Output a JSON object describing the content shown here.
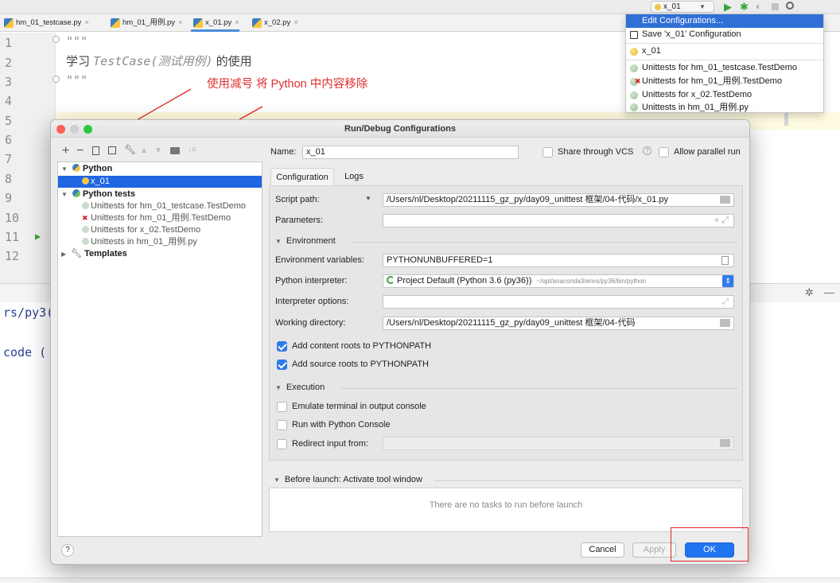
{
  "run_toolbar": {
    "config_name": "x_01",
    "dropdown_arrow": "▼"
  },
  "tabs": [
    {
      "label": "hm_01_testcase.py"
    },
    {
      "label": "hm_01_用例.py"
    },
    {
      "label": "x_01.py"
    },
    {
      "label": "x_02.py"
    }
  ],
  "editor": {
    "line_numbers": [
      "1",
      "2",
      "3",
      "4",
      "5",
      "6",
      "7",
      "8",
      "9",
      "10",
      "11",
      "12"
    ],
    "code_line1": "\"\"\"",
    "code_line2_prefix": "学习 ",
    "code_line2_italic": "TestCase(测试用例)",
    "code_line2_suffix": " 的使用",
    "code_line3": "\"\"\""
  },
  "annotation": "使用减号 将 Python 中内容移除",
  "console": {
    "line1": "rs/py3(",
    "line2": "code ("
  },
  "dropdown": {
    "items": [
      {
        "label": "Edit Configurations...",
        "icon": "none",
        "selected": true
      },
      {
        "label": "Save 'x_01' Configuration",
        "icon": "save-icon"
      },
      {
        "label": "x_01",
        "icon": "python-icon"
      },
      {
        "label": "Unittests for hm_01_testcase.TestDemo",
        "icon": "unittest-icon"
      },
      {
        "label": "Unittests for hm_01_用例.TestDemo",
        "icon": "unittest-error-icon"
      },
      {
        "label": "Unittests for x_02.TestDemo",
        "icon": "unittest-icon"
      },
      {
        "label": "Unittests in hm_01_用例.py",
        "icon": "unittest-icon"
      }
    ]
  },
  "dialog": {
    "title": "Run/Debug Configurations",
    "toolbar_icons": [
      "add-icon",
      "remove-icon",
      "copy-icon",
      "save-icon",
      "wrench-icon",
      "move-up-icon",
      "move-down-icon",
      "folder-icon",
      "sort-icon"
    ],
    "tree": [
      {
        "label": "Python",
        "level": 0,
        "expanded": true,
        "bold": true
      },
      {
        "label": "x_01",
        "level": 1,
        "selected": true
      },
      {
        "label": "Python tests",
        "level": 0,
        "expanded": true,
        "bold": true
      },
      {
        "label": "Unittests for hm_01_testcase.TestDemo",
        "level": 1
      },
      {
        "label": "Unittests for hm_01_用例.TestDemo",
        "level": 1,
        "error": true
      },
      {
        "label": "Unittests for x_02.TestDemo",
        "level": 1
      },
      {
        "label": "Unittests in hm_01_用例.py",
        "level": 1
      },
      {
        "label": "Templates",
        "level": 0,
        "expanded": false,
        "bold": true
      }
    ],
    "name_label": "Name:",
    "name_value": "x_01",
    "share_vcs_label": "Share through VCS",
    "allow_parallel_label": "Allow parallel run",
    "tab_configuration": "Configuration",
    "tab_logs": "Logs",
    "script_path_label": "Script path:",
    "script_path_value": "/Users/nl/Desktop/20211115_gz_py/day09_unittest 框架/04-代码/x_01.py",
    "parameters_label": "Parameters:",
    "parameters_value": "",
    "environment_section": "Environment",
    "env_vars_label": "Environment variables:",
    "env_vars_value": "PYTHONUNBUFFERED=1",
    "interpreter_label": "Python interpreter:",
    "interpreter_value": "Project Default (Python 3.6 (py36))",
    "interpreter_path": "~/opt/anaconda3/envs/py36/bin/python",
    "interp_options_label": "Interpreter options:",
    "interp_options_value": "",
    "working_dir_label": "Working directory:",
    "working_dir_value": "/Users/nl/Desktop/20211115_gz_py/day09_unittest 框架/04-代码",
    "add_content_roots": {
      "label": "Add content roots to PYTHONPATH",
      "checked": true
    },
    "add_source_roots": {
      "label": "Add source roots to PYTHONPATH",
      "checked": true
    },
    "execution_section": "Execution",
    "emulate_terminal": {
      "label": "Emulate terminal in output console",
      "checked": false
    },
    "run_with_console": {
      "label": "Run with Python Console",
      "checked": false
    },
    "redirect_input": {
      "label": "Redirect input from:",
      "checked": false
    },
    "before_launch_section": "Before launch: Activate tool window",
    "no_tasks_text": "There are no tasks to run before launch",
    "help_label": "?",
    "cancel_label": "Cancel",
    "apply_label": "Apply",
    "ok_label": "OK"
  },
  "colors": {
    "accent": "#1f66e0",
    "annotation": "#e03030",
    "highlight_box": "#e02424"
  }
}
